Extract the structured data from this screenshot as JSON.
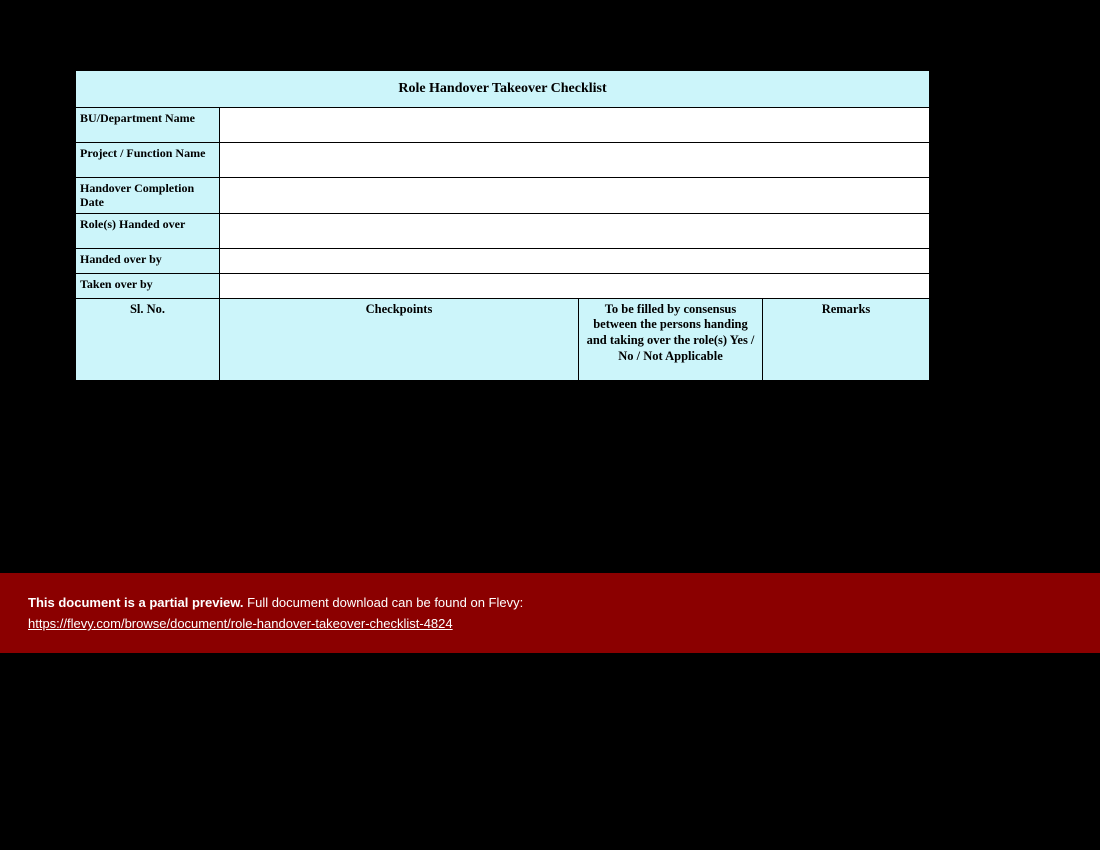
{
  "title": "Role Handover Takeover Checklist",
  "fields": [
    {
      "label": "BU/Department Name",
      "value": ""
    },
    {
      "label": "Project / Function Name",
      "value": ""
    },
    {
      "label": "Handover Completion Date",
      "value": ""
    },
    {
      "label": "Role(s) Handed over",
      "value": ""
    },
    {
      "label": "Handed over by",
      "value": ""
    },
    {
      "label": "Taken over by",
      "value": ""
    }
  ],
  "columns": {
    "c1": "Sl. No.",
    "c2": "Checkpoints",
    "c3": "To be filled by consensus between the persons handing and taking over the role(s) Yes / No / Not Applicable",
    "c4": "Remarks"
  },
  "banner": {
    "bold": "This document is a partial preview.",
    "rest": "  Full document download can be found on Flevy:",
    "url": "https://flevy.com/browse/document/role-handover-takeover-checklist-4824"
  }
}
